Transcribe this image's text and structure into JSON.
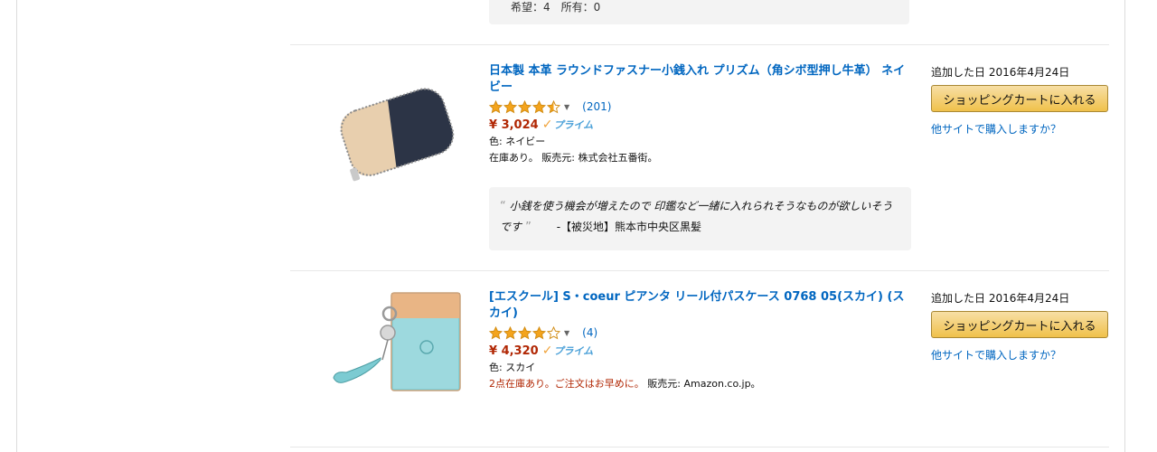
{
  "top_quote": {
    "wishlist_text": "希望：4　所有：0"
  },
  "items": [
    {
      "title": "日本製 本革 ラウンドファスナー小銭入れ プリズム（角シボ型押し牛革） ネイビー",
      "rating": 4.5,
      "review_count": "(201)",
      "price": "¥ 3,024",
      "prime_label": "プライム",
      "color_text": "色: ネイビー",
      "stock_text": "在庫あり。",
      "seller_text": "販売元: 株式会社五番街。",
      "quote_text": "小銭を使う機会が増えたので 印鑑など一緒に入れられそうなものが欲しいそうです",
      "quote_author": "-【被災地】熊本市中央区黒髪",
      "added_date": "追加した日 2016年4月24日",
      "cart_button": "ショッピングカートに入れる",
      "other_site_link": "他サイトで購入しますか？"
    },
    {
      "title": "[エスクール] S・coeur ピアンタ リール付パスケース 0768 05(スカイ) (スカイ)",
      "rating": 4,
      "review_count": "(4)",
      "price": "¥ 4,320",
      "prime_label": "プライム",
      "color_text": "色: スカイ",
      "stock_text": "2点在庫あり。ご注文はお早めに。",
      "seller_text": "販売元: Amazon.co.jp。",
      "added_date": "追加した日 2016年4月24日",
      "cart_button": "ショッピングカートに入れる",
      "other_site_link": "他サイトで購入しますか？"
    }
  ],
  "colors": {
    "link": "#0066c0",
    "price": "#b12704",
    "star": "#f4a41c",
    "button": "#f0c14b",
    "prime": "#4aa0d8"
  },
  "icons": {
    "star": "star-icon",
    "prime_check": "checkmark-icon",
    "caret": "chevron-down-icon",
    "quote": "quote-mark-icon"
  }
}
